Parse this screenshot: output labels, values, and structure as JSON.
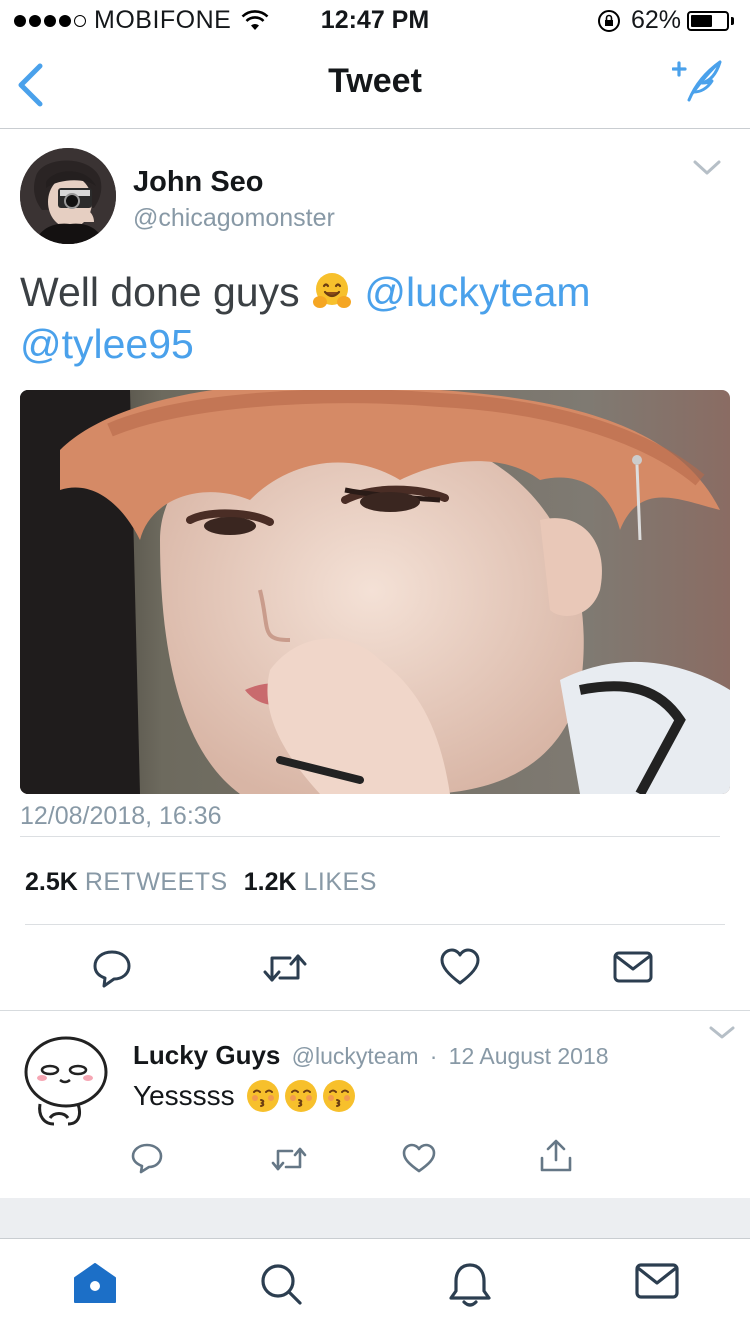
{
  "status_bar": {
    "carrier": "MOBIFONE",
    "signal_bars": 4,
    "time": "12:47 PM",
    "battery_text": "62%",
    "battery_level": 0.62
  },
  "nav": {
    "title": "Tweet"
  },
  "tweet": {
    "author_name": "John Seo",
    "author_handle": "@chicagomonster",
    "text_prefix": "Well done guys",
    "mention1": "@luckyteam",
    "mention2": "@tylee95",
    "timestamp": "12/08/2018, 16:36",
    "retweets_count": "2.5K",
    "retweets_label": "RETWEETS",
    "likes_count": "1.2K",
    "likes_label": "LIKES"
  },
  "reply": {
    "name": "Lucky Guys",
    "handle": "@luckyteam",
    "separator": "·",
    "date": "12 August 2018",
    "text": "Yesssss"
  },
  "colors": {
    "accent": "#4aa1eb",
    "secondary_text": "#8899a6",
    "icon_gray": "#657786",
    "tab_active": "#1c6fc7",
    "tab_inactive": "#2c3e50"
  },
  "icons": [
    "back-chevron-icon",
    "compose-tweet-icon",
    "caret-down-icon",
    "reply-icon",
    "retweet-icon",
    "like-icon",
    "direct-message-icon",
    "share-icon",
    "home-icon",
    "search-icon",
    "notifications-icon",
    "messages-icon"
  ]
}
